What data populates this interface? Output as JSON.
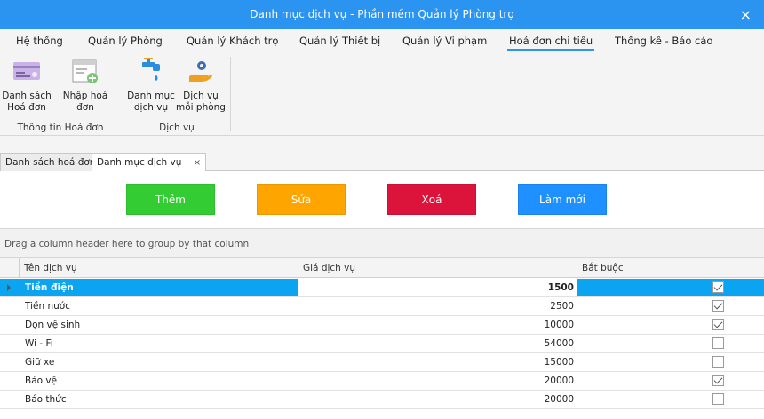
{
  "window": {
    "title": "Danh mục dịch vụ - Phần mềm Quản lý Phòng trọ",
    "close_glyph": "×"
  },
  "menu": {
    "items": [
      {
        "label": "Hệ thống"
      },
      {
        "label": "Quản lý Phòng"
      },
      {
        "label": "Quản lý Khách trọ"
      },
      {
        "label": "Quản lý Thiết bị"
      },
      {
        "label": "Quản lý Vi phạm"
      },
      {
        "label": "Hoá đơn chi tiêu"
      },
      {
        "label": "Thống kê - Báo cáo"
      }
    ],
    "active_index": 5
  },
  "ribbon": {
    "groups": [
      {
        "label": "Thông tin Hoá đơn",
        "buttons": [
          {
            "label_line1": "Danh sách",
            "label_line2": "Hoá đơn",
            "icon": "invoice-list-icon"
          },
          {
            "label_line1": "Nhập hoá đơn",
            "label_line2": "",
            "icon": "add-invoice-icon"
          }
        ]
      },
      {
        "label": "Dịch vụ",
        "buttons": [
          {
            "label_line1": "Danh mục",
            "label_line2": "dịch vụ",
            "icon": "water-tap-icon"
          },
          {
            "label_line1": "Dịch vụ",
            "label_line2": "mỗi phòng",
            "icon": "hand-gear-icon"
          }
        ]
      }
    ]
  },
  "doc_tabs": [
    {
      "label": "Danh sách hoá đơn"
    },
    {
      "label": "Danh mục dịch vụ",
      "close": "×"
    }
  ],
  "actions": {
    "add": "Thêm",
    "edit": "Sửa",
    "delete": "Xoá",
    "refresh": "Làm mới"
  },
  "colors": {
    "titlebar": "#2b93f0",
    "add": "#33cc33",
    "edit": "#ffa500",
    "delete": "#dc143c",
    "refresh": "#1e90ff",
    "selected_row": "#0aa4f1"
  },
  "grid": {
    "group_panel_text": "Drag a column header here to group by that column",
    "columns": [
      "Tên dịch vụ",
      "Giá dịch vụ",
      "Bắt buộc"
    ],
    "rows": [
      {
        "name": "Tiền điện",
        "price": "1500",
        "required": true
      },
      {
        "name": "Tiền nước",
        "price": "2500",
        "required": true
      },
      {
        "name": "Dọn vệ sinh",
        "price": "10000",
        "required": true
      },
      {
        "name": "Wi - Fi",
        "price": "54000",
        "required": false
      },
      {
        "name": "Giữ xe",
        "price": "15000",
        "required": false
      },
      {
        "name": "Bảo vệ",
        "price": "20000",
        "required": true
      },
      {
        "name": "Báo thức",
        "price": "20000",
        "required": false
      }
    ],
    "selected_index": 0
  }
}
